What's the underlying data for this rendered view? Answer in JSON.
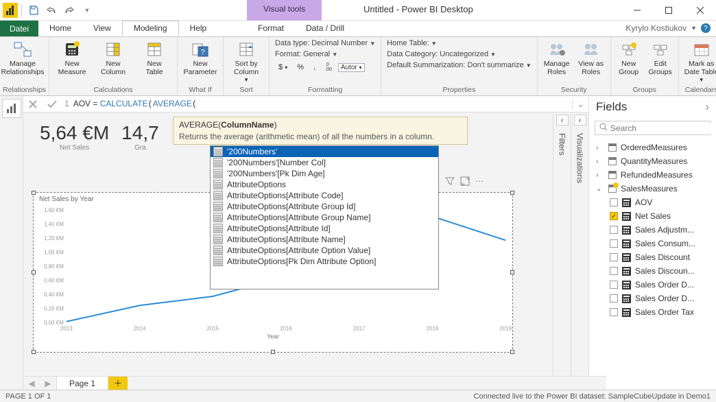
{
  "title": "Untitled - Power BI Desktop",
  "visual_tools_label": "Visual tools",
  "user_name": "Kyrylo Kostiukov",
  "tabs": {
    "file": "Datei",
    "home": "Home",
    "view": "View",
    "modeling": "Modeling",
    "help": "Help",
    "format": "Format",
    "datadrill": "Data / Drill"
  },
  "ribbon": {
    "relationships": {
      "label": "Manage\nRelationships",
      "group": "Relationships"
    },
    "calculations": {
      "measure": "New\nMeasure",
      "column": "New\nColumn",
      "table": "New\nTable",
      "group": "Calculations"
    },
    "whatif": {
      "parameter": "New\nParameter",
      "group": "What If"
    },
    "sort": {
      "sortby": "Sort by\nColumn",
      "group": "Sort"
    },
    "formatting": {
      "datatype": "Data type: Decimal Number",
      "format": "Format: General",
      "auto": "Autor",
      "group": "Formatting"
    },
    "properties": {
      "hometable": "Home Table:",
      "datacategory": "Data Category: Uncategorized",
      "summarization": "Default Summarization: Don't summarize",
      "group": "Properties"
    },
    "security": {
      "manage": "Manage\nRoles",
      "viewas": "View as\nRoles",
      "group": "Security"
    },
    "groups": {
      "new": "New\nGroup",
      "edit": "Edit\nGroups",
      "group": "Groups"
    },
    "calendars": {
      "mark": "Mark as\nDate Table",
      "group": "Calendars"
    }
  },
  "formula": {
    "line": "1",
    "text_prefix": "AOV = ",
    "kw1": "CALCULATE",
    "kw2": "AVERAGE"
  },
  "tooltip": {
    "sig_prefix": "AVERAGE(",
    "sig_bold": "ColumnName",
    "sig_suffix": ")",
    "desc": "Returns the average (arithmetic mean) of all the numbers in a column."
  },
  "autocomplete": [
    "'200Numbers'",
    "'200Numbers'[Number Col]",
    "'200Numbers'[Pk Dim Age]",
    "AttributeOptions",
    "AttributeOptions[Attribute Code]",
    "AttributeOptions[Attribute Group Id]",
    "AttributeOptions[Attribute Group Name]",
    "AttributeOptions[Attribute Id]",
    "AttributeOptions[Attribute Name]",
    "AttributeOptions[Attribute Option Value]",
    "AttributeOptions[Pk Dim Attribute Option]"
  ],
  "cards": [
    {
      "value": "5,64 €M",
      "label": "Net Sales"
    },
    {
      "value": "14,7",
      "label": "Gra"
    }
  ],
  "chart": {
    "title": "Net Sales by Year"
  },
  "chart_data": {
    "type": "line",
    "xlabel": "Year",
    "ylabel": "",
    "categories": [
      "2013",
      "2014",
      "2015",
      "2016",
      "2017",
      "2018",
      "2019"
    ],
    "yticks": [
      "0,00 €M",
      "0,20 €M",
      "0,40 €M",
      "0,60 €M",
      "0,80 €M",
      "1,00 €M",
      "1,20 €M",
      "1,40 €M",
      "1,60 €M"
    ],
    "series": [
      {
        "name": "Net Sales",
        "values": [
          0.01,
          0.24,
          0.37,
          0.65,
          0.94,
          1.51,
          1.17
        ]
      }
    ],
    "ylim": [
      0,
      1.6
    ]
  },
  "side_panels": {
    "filters": "Filters",
    "visualizations": "Visualizations"
  },
  "fields": {
    "title": "Fields",
    "search_placeholder": "Search",
    "groups": [
      {
        "name": "OrderedMeasures",
        "expanded": false
      },
      {
        "name": "QuantityMeasures",
        "expanded": false
      },
      {
        "name": "RefundedMeasures",
        "expanded": false
      },
      {
        "name": "SalesMeasures",
        "expanded": true,
        "highlight": true
      }
    ],
    "items": [
      {
        "name": "AOV",
        "checked": false
      },
      {
        "name": "Net Sales",
        "checked": true
      },
      {
        "name": "Sales Adjustm...",
        "checked": false
      },
      {
        "name": "Sales Consum...",
        "checked": false
      },
      {
        "name": "Sales Discount",
        "checked": false
      },
      {
        "name": "Sales Discoun...",
        "checked": false
      },
      {
        "name": "Sales Order D...",
        "checked": false
      },
      {
        "name": "Sales Order D...",
        "checked": false
      },
      {
        "name": "Sales Order Tax",
        "checked": false
      }
    ]
  },
  "page_tab": "Page 1",
  "status": {
    "left": "PAGE 1 OF 1",
    "right": "Connected live to the Power BI dataset: SampleCubeUpdate in Demo1"
  }
}
